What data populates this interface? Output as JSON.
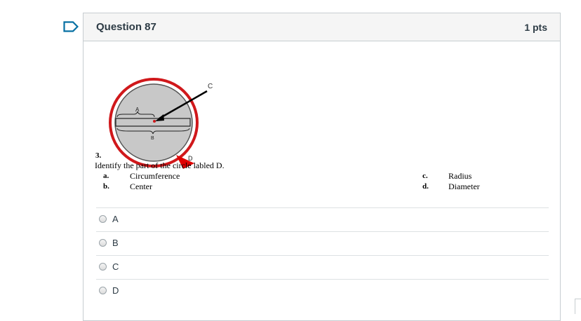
{
  "question": {
    "title": "Question 87",
    "points": "1 pts"
  },
  "figure": {
    "label_a": "A",
    "label_b": "B",
    "label_c": "C",
    "label_d": "D"
  },
  "prompt": {
    "number": "3.",
    "text": "Identify the part of the circle labled D.",
    "choices": [
      {
        "letter": "a.",
        "text": "Circumference"
      },
      {
        "letter": "b.",
        "text": "Center"
      },
      {
        "letter": "c.",
        "text": "Radius"
      },
      {
        "letter": "d.",
        "text": "Diameter"
      }
    ]
  },
  "answers": [
    {
      "label": "A"
    },
    {
      "label": "B"
    },
    {
      "label": "C"
    },
    {
      "label": "D"
    }
  ],
  "icons": {
    "flag": "bookmark-flag-icon",
    "radio": "radio-button-icon"
  },
  "colors": {
    "flag": "#0770a3",
    "circle_ring": "#d0181b",
    "circle_fill": "#c8c8c8"
  }
}
